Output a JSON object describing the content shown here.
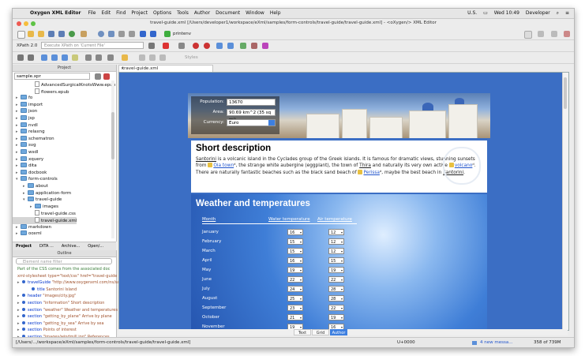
{
  "menubar": {
    "app": "Oxygen XML Editor",
    "menus": [
      "File",
      "Edit",
      "Find",
      "Project",
      "Options",
      "Tools",
      "Author",
      "Document",
      "Window",
      "Help"
    ],
    "input_source": "U.S.",
    "clock": "Wed 10:49",
    "user": "Developer"
  },
  "window_title": "travel-guide.xml [/Users/developer1/workspace/eXml/samples/form-controls/travel-guide/travel-guide.xml] - <oXygen/> XML Editor",
  "toolbar": {
    "transform_scenario": "printenv",
    "xpath_version": "XPath 2.0",
    "xpath_placeholder": "Execute XPath on 'Current File'",
    "styles_label": "Styles"
  },
  "project": {
    "panel_title": "Project",
    "selector": "sample.xpr",
    "tree": [
      {
        "label": "AdvancedSurgicalKnotsWww.epub",
        "depth": 2,
        "kind": "file",
        "expanded": null
      },
      {
        "label": "flowers.epub",
        "depth": 2,
        "kind": "file",
        "expanded": null
      },
      {
        "label": "fo",
        "depth": 0,
        "kind": "folder",
        "expanded": false
      },
      {
        "label": "import",
        "depth": 0,
        "kind": "folder",
        "expanded": false
      },
      {
        "label": "json",
        "depth": 0,
        "kind": "folder",
        "expanded": false
      },
      {
        "label": "jsp",
        "depth": 0,
        "kind": "folder",
        "expanded": false
      },
      {
        "label": "nvdl",
        "depth": 0,
        "kind": "folder",
        "expanded": false
      },
      {
        "label": "relaxng",
        "depth": 0,
        "kind": "folder",
        "expanded": false
      },
      {
        "label": "schematron",
        "depth": 0,
        "kind": "folder",
        "expanded": false
      },
      {
        "label": "svg",
        "depth": 0,
        "kind": "folder",
        "expanded": false
      },
      {
        "label": "wsdl",
        "depth": 0,
        "kind": "folder",
        "expanded": false
      },
      {
        "label": "xquery",
        "depth": 0,
        "kind": "folder",
        "expanded": false
      },
      {
        "label": "dita",
        "depth": 0,
        "kind": "folder",
        "expanded": false
      },
      {
        "label": "docbook",
        "depth": 0,
        "kind": "folder",
        "expanded": false
      },
      {
        "label": "form-controls",
        "depth": 0,
        "kind": "folder",
        "expanded": true
      },
      {
        "label": "about",
        "depth": 1,
        "kind": "folder",
        "expanded": false
      },
      {
        "label": "application-form",
        "depth": 1,
        "kind": "folder",
        "expanded": false
      },
      {
        "label": "travel-guide",
        "depth": 1,
        "kind": "folder",
        "expanded": true
      },
      {
        "label": "images",
        "depth": 2,
        "kind": "folder",
        "expanded": false
      },
      {
        "label": "travel-guide.css",
        "depth": 2,
        "kind": "file",
        "expanded": null
      },
      {
        "label": "travel-guide.xml",
        "depth": 2,
        "kind": "file",
        "expanded": null,
        "selected": true
      },
      {
        "label": "markdown",
        "depth": 0,
        "kind": "folder",
        "expanded": false
      },
      {
        "label": "ooxml",
        "depth": 0,
        "kind": "folder",
        "expanded": false
      }
    ],
    "tabs": [
      "Project",
      "DITA ...",
      "Archive...",
      "Open/..."
    ]
  },
  "outline": {
    "panel_title": "Outline",
    "filter_placeholder": "Element name filter",
    "rows": [
      {
        "type": "comment",
        "text": "Part of the CSS comes from the associated doc"
      },
      {
        "type": "pi",
        "text": "xml-stylesheet type=\"text/css\" href=\"travel-guide"
      },
      {
        "type": "element",
        "name": "travelGuide",
        "rest": "\"http://www.oxygenxml.com/ns/sam"
      },
      {
        "type": "child",
        "name": "title",
        "rest": "Santorini Island"
      },
      {
        "type": "element",
        "name": "header",
        "rest": "\"images/city.jpg\""
      },
      {
        "type": "element",
        "name": "section",
        "rest": "\"information\" Short description"
      },
      {
        "type": "element",
        "name": "section",
        "rest": "\"weather\" Weather and temperatures"
      },
      {
        "type": "element",
        "name": "section",
        "rest": "\"getting_by_plane\" Arrive by plane"
      },
      {
        "type": "element",
        "name": "section",
        "rest": "\"getting_by_sea\" Arrive by sea"
      },
      {
        "type": "element",
        "name": "section",
        "rest": "Points of interest"
      },
      {
        "type": "element",
        "name": "section",
        "rest": "\"images/windmill.jpg\" References"
      }
    ]
  },
  "editor": {
    "tab_title": "travel-guide.xml",
    "header_fields": [
      {
        "label": "Population:",
        "value": "13670"
      },
      {
        "label": "Area:",
        "value": "90.69 km^2 (35 sq mi)"
      },
      {
        "label": "Currency:",
        "value": "Euro"
      }
    ],
    "short_description": {
      "heading": "Short description",
      "p1": "Santorini",
      "p2": " is a volcanic island in the Cyclades group of the Greek islands. It is famous for dramatic views, stunning sunsets from ",
      "link1": "Oia town",
      "p3": "ᵈ, the strange white aubergine (eggplant), the town of ",
      "t1": "Thira",
      "p4": " and naturally its very own active ",
      "link2": "volcano",
      "p5": "ᵈ. There are naturally fantastic beaches such as the black sand beach of ",
      "link3": "Perissa",
      "p6": "ᵈ, maybe the best beach in ",
      "t2": "Santorini",
      "p7": "."
    },
    "weather": {
      "heading": "Weather and temperatures",
      "col_month": "Month",
      "col_water": "Water temperature",
      "col_air": "Air temperature",
      "rows": [
        {
          "month": "January",
          "water": "16",
          "air": "12"
        },
        {
          "month": "February",
          "water": "15",
          "air": "12"
        },
        {
          "month": "March",
          "water": "15",
          "air": "12"
        },
        {
          "month": "April",
          "water": "16",
          "air": "15"
        },
        {
          "month": "May",
          "water": "19",
          "air": "19"
        },
        {
          "month": "June",
          "water": "22",
          "air": "22"
        },
        {
          "month": "July",
          "water": "24",
          "air": "28"
        },
        {
          "month": "August",
          "water": "25",
          "air": "28"
        },
        {
          "month": "September",
          "water": "23",
          "air": "22"
        },
        {
          "month": "October",
          "water": "21",
          "air": "19"
        },
        {
          "month": "November",
          "water": "19",
          "air": "16"
        }
      ]
    },
    "mode_tabs": [
      "Text",
      "Grid",
      "Author"
    ],
    "active_mode": "Author"
  },
  "status": {
    "path": "[/Users/.../workspace/eXml/samples/form-controls/travel-guide/travel-guide.xml]",
    "codepoint": "U+0000",
    "messages": "4 new messa...",
    "memory": "358 of 739M"
  },
  "colors": {
    "accent": "#3d7fe0",
    "banner_panel": "#1e1e1e",
    "weather_bg": "#2656b0",
    "link": "#2255cc"
  }
}
